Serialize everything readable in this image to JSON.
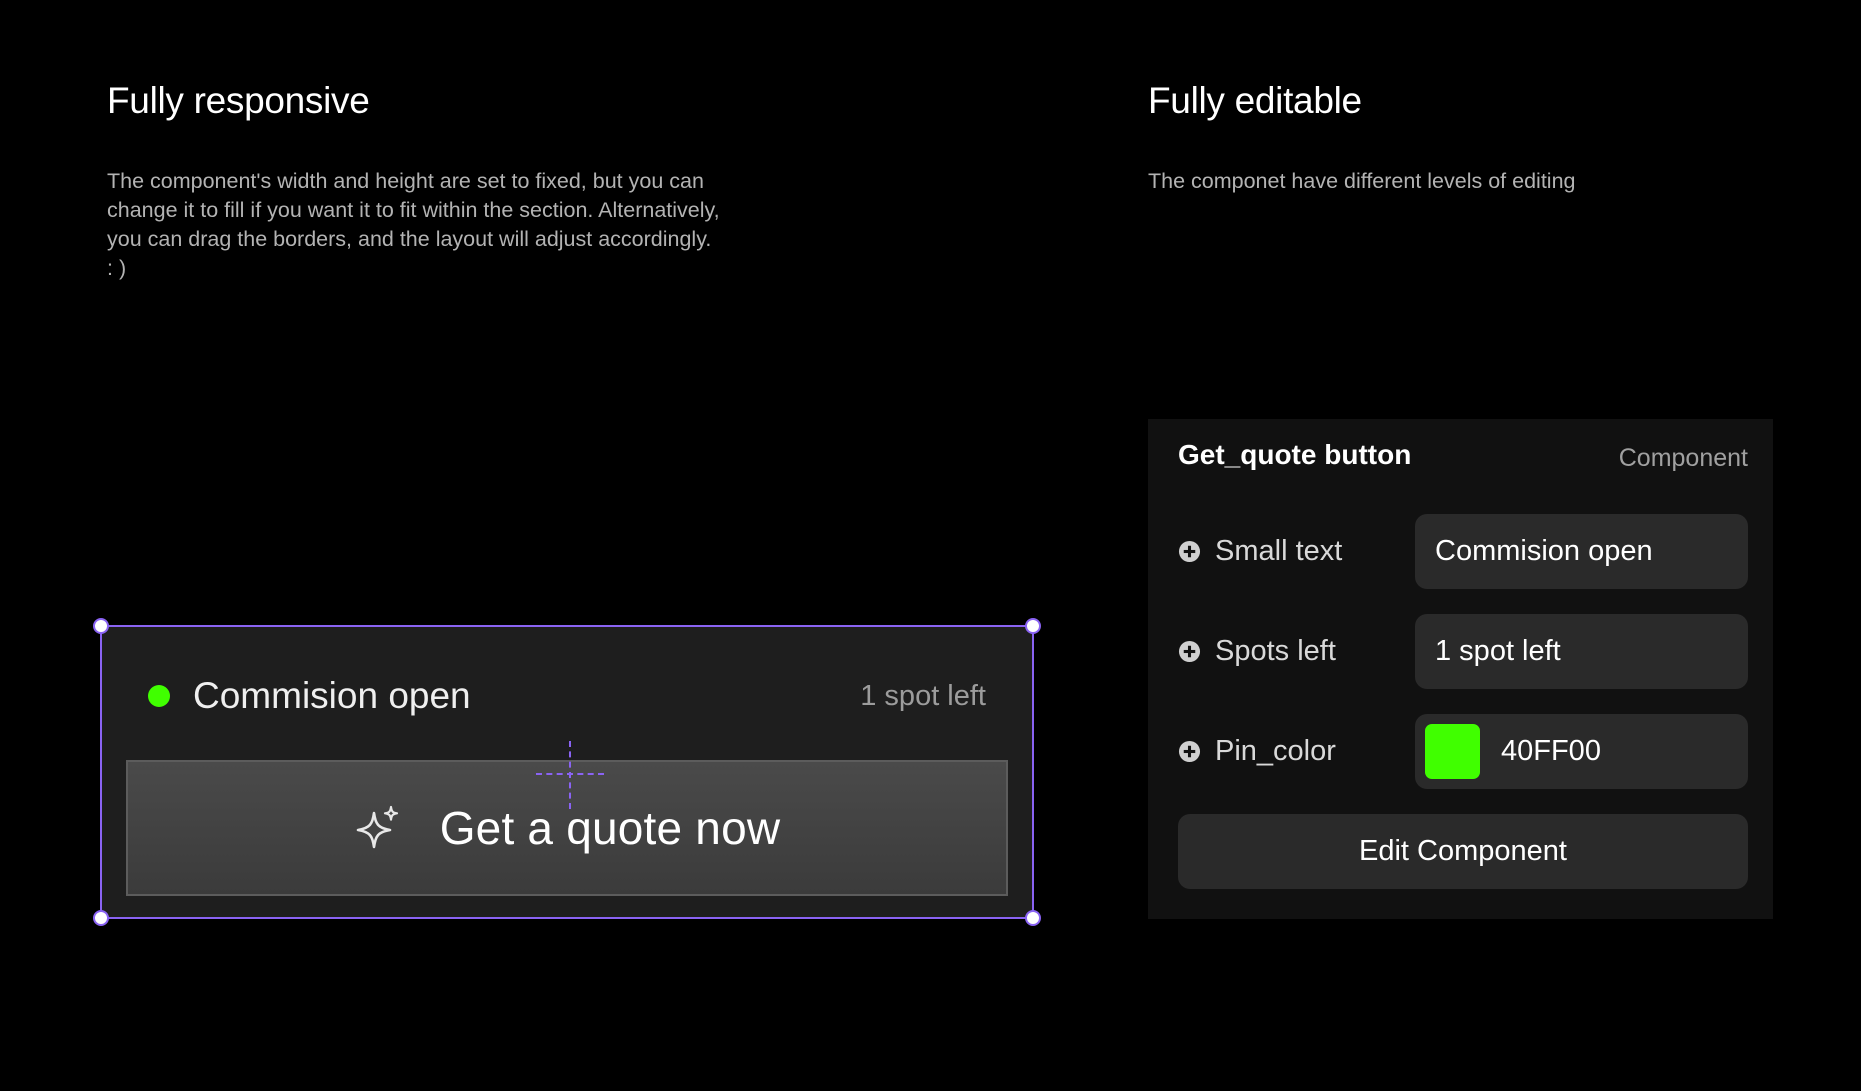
{
  "left_section": {
    "title": "Fully responsive",
    "description_lines": [
      "The component's width and height are set to fixed, but you can",
      "change it to fill if you want it to fit within the section. Alternatively,",
      "you can drag the borders, and the layout will adjust accordingly.",
      ": )"
    ]
  },
  "right_section": {
    "title": "Fully editable",
    "description": "The componet have different levels of editing"
  },
  "preview": {
    "status_text": "Commision open",
    "spots_text": "1 spot left",
    "button_label": "Get a quote now",
    "button_icon": "sparkle-icon",
    "pin_color": "#40FF00",
    "selection_color": "#8A63F3"
  },
  "panel": {
    "title": "Get_quote button",
    "type_label": "Component",
    "properties": [
      {
        "label": "Small text",
        "value": "Commision open",
        "icon": "plus-circle-icon"
      },
      {
        "label": "Spots left",
        "value": "1 spot left",
        "icon": "plus-circle-icon"
      },
      {
        "label": "Pin_color",
        "value": "40FF00",
        "swatch": "#40FF00",
        "icon": "plus-circle-icon"
      }
    ],
    "edit_button_label": "Edit Component"
  }
}
